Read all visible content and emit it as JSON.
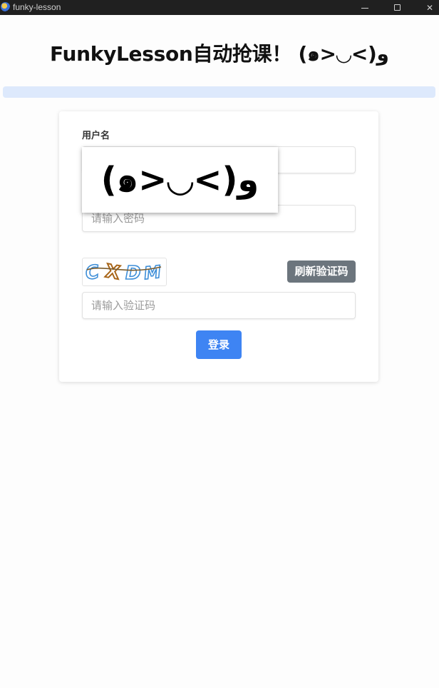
{
  "window": {
    "title": "funky-lesson",
    "minimize_icon": "minimize-icon",
    "maximize_icon": "maximize-icon",
    "close_icon": "close-icon",
    "close_glyph": "✕"
  },
  "page": {
    "title": "FunkyLesson自动抢课！ (๑>◡<)و"
  },
  "progress": {
    "value": 0
  },
  "form": {
    "username_label": "用户名",
    "username_value": "",
    "password_placeholder": "请输入密码",
    "password_value": "",
    "captcha_text": "CXDM",
    "refresh_label": "刷新验证码",
    "captcha_placeholder": "请输入验证码",
    "captcha_value": "",
    "login_label": "登录"
  },
  "popup": {
    "emote": "(๑>◡<)و"
  },
  "colors": {
    "titlebar": "#202020",
    "progress_track": "#dde9fc",
    "refresh_button": "#6c757d",
    "login_button": "#3e84f3"
  }
}
